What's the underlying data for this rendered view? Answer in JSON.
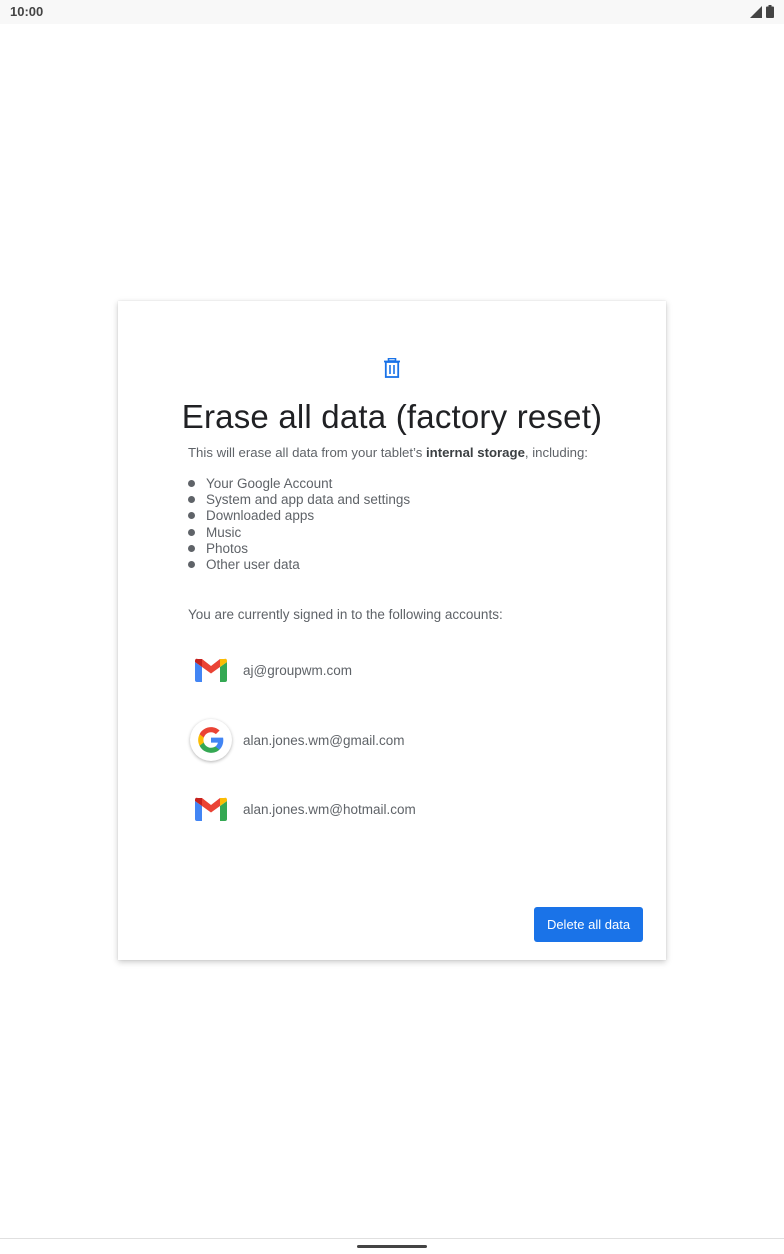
{
  "status_bar": {
    "time": "10:00",
    "signal_icon": "signal-icon",
    "battery_icon": "battery-icon"
  },
  "dialog": {
    "icon": "trash-icon",
    "title": "Erase all data (factory reset)",
    "intro_before": "This will erase all data from your tablet’s ",
    "intro_bold": "internal storage",
    "intro_after": ", including:",
    "items": [
      "Your Google Account",
      "System and app data and settings",
      "Downloaded apps",
      "Music",
      "Photos",
      "Other user data"
    ],
    "accounts_intro": "You are currently signed in to the following accounts:",
    "accounts": [
      {
        "icon": "gmail-icon",
        "email": "aj@groupwm.com"
      },
      {
        "icon": "google-icon",
        "email": "alan.jones.wm@gmail.com"
      },
      {
        "icon": "gmail-icon",
        "email": "alan.jones.wm@hotmail.com"
      }
    ],
    "button_label": "Delete all data"
  },
  "colors": {
    "accent": "#1a73e8",
    "text_primary": "#202124",
    "text_secondary": "#5f6368"
  }
}
